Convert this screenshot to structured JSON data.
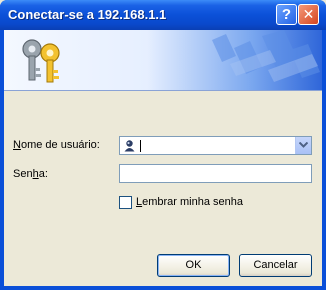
{
  "window": {
    "title": "Conectar-se a 192.168.1.1",
    "help_glyph": "?",
    "close_glyph": "✕",
    "titlebar_color": "#0a4fd8"
  },
  "banner": {
    "icon": "keys-icon"
  },
  "form": {
    "username_label_first": "N",
    "username_label_rest": "ome de usuário:",
    "password_label_first": "Sen",
    "password_label_u": "h",
    "password_label_rest": "a:",
    "username_value": "",
    "password_value": "",
    "remember_label_first": "L",
    "remember_label_rest": "embrar minha senha",
    "remember_checked": false
  },
  "buttons": {
    "ok_label": "OK",
    "cancel_label": "Cancelar"
  }
}
